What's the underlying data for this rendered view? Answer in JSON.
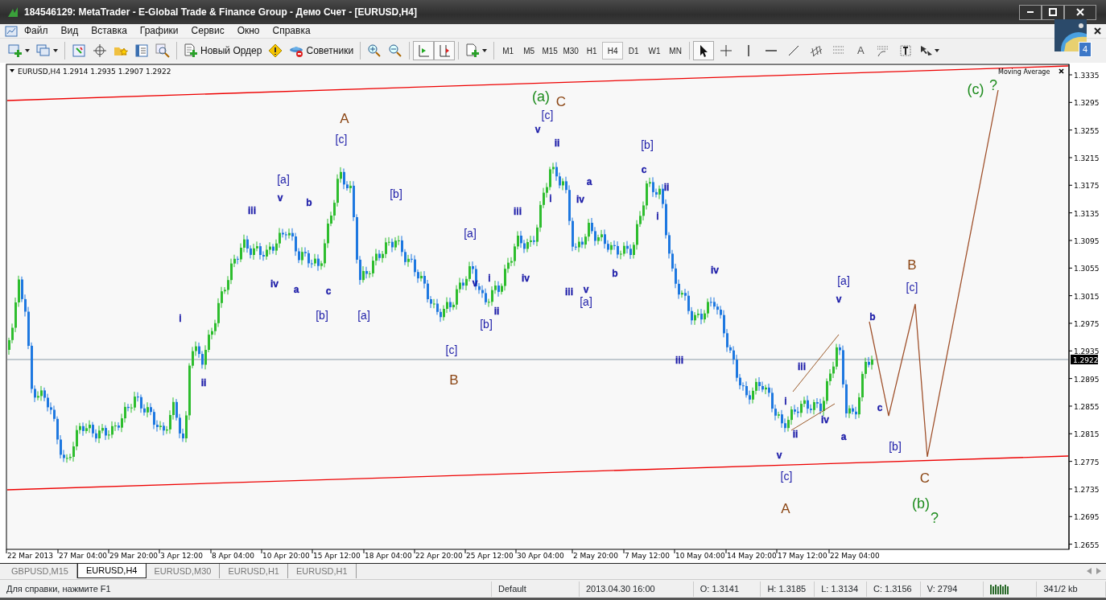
{
  "window": {
    "title": "184546129: MetaTrader - E-Global Trade & Finance Group - Демо Счет - [EURUSD,H4]"
  },
  "menu": [
    "Файл",
    "Вид",
    "Вставка",
    "Графики",
    "Сервис",
    "Окно",
    "Справка"
  ],
  "toolbar": {
    "new_order": "Новый Ордер",
    "experts": "Советники",
    "autoscroll_on": true,
    "chart_shift_on": true
  },
  "timeframes": [
    {
      "label": "M1",
      "selected": false
    },
    {
      "label": "M5",
      "selected": false
    },
    {
      "label": "M15",
      "selected": false
    },
    {
      "label": "M30",
      "selected": false
    },
    {
      "label": "H1",
      "selected": false
    },
    {
      "label": "H4",
      "selected": true
    },
    {
      "label": "D1",
      "selected": false
    },
    {
      "label": "W1",
      "selected": false
    },
    {
      "label": "MN",
      "selected": false
    }
  ],
  "draw_tools": [
    {
      "kind": "cursor",
      "selected": true
    },
    {
      "kind": "crosshair",
      "selected": false
    },
    {
      "kind": "vline",
      "selected": false
    },
    {
      "kind": "hline",
      "selected": false
    },
    {
      "kind": "trendline",
      "selected": false
    },
    {
      "kind": "channel",
      "selected": false
    },
    {
      "kind": "fibo",
      "selected": false
    },
    {
      "kind": "text",
      "label": "A",
      "selected": false
    },
    {
      "kind": "fibofan",
      "selected": false
    },
    {
      "kind": "textlabel",
      "selected": false
    },
    {
      "kind": "arrows",
      "selected": false
    }
  ],
  "notification": {
    "count": "4"
  },
  "chart": {
    "header": "EURUSD,H4  1.2914 1.2935 1.2907 1.2922",
    "indicator": "Moving Average",
    "current_price": "1.2922",
    "price_labels": [
      "1.3335",
      "1.3295",
      "1.3255",
      "1.3215",
      "1.3175",
      "1.3135",
      "1.3095",
      "1.3055",
      "1.3015",
      "1.2975",
      "1.2935",
      "1.2895",
      "1.2855",
      "1.2815",
      "1.2775",
      "1.2735",
      "1.2695",
      "1.2655"
    ],
    "time_labels": [
      "22 Mar 2013",
      "27 Mar 04:00",
      "29 Mar 20:00",
      "3 Apr 12:00",
      "8 Apr 04:00",
      "10 Apr 20:00",
      "15 Apr 12:00",
      "18 Apr 04:00",
      "22 Apr 20:00",
      "25 Apr 12:00",
      "30 Apr 04:00",
      "2 May 20:00",
      "7 May 12:00",
      "10 May 04:00",
      "14 May 20:00",
      "17 May 12:00",
      "22 May 04:00"
    ],
    "wave_labels": [
      {
        "text": "(a)",
        "color": "#1e8c1e"
      },
      {
        "text": "C",
        "color": "#8b4513"
      },
      {
        "text": "(c)",
        "color": "#1e8c1e"
      },
      {
        "text": "?",
        "color": "#1e8c1e"
      },
      {
        "text": "A",
        "color": "#8b4513"
      },
      {
        "text": "[c]",
        "color": "#1c1ca8"
      },
      {
        "text": "[c]",
        "color": "#1c1ca8"
      },
      {
        "text": "v",
        "color": "#1c1ca8"
      },
      {
        "text": "ii",
        "color": "#1c1ca8"
      },
      {
        "text": "[b]",
        "color": "#1c1ca8"
      },
      {
        "text": "[a]",
        "color": "#1c1ca8"
      },
      {
        "text": "c",
        "color": "#1c1ca8"
      },
      {
        "text": "a",
        "color": "#1c1ca8"
      },
      {
        "text": "ii",
        "color": "#1c1ca8"
      },
      {
        "text": "v",
        "color": "#1c1ca8"
      },
      {
        "text": "b",
        "color": "#1c1ca8"
      },
      {
        "text": "[b]",
        "color": "#1c1ca8"
      },
      {
        "text": "i",
        "color": "#1c1ca8"
      },
      {
        "text": "iv",
        "color": "#1c1ca8"
      },
      {
        "text": "iii",
        "color": "#1c1ca8"
      },
      {
        "text": "iii",
        "color": "#1c1ca8"
      },
      {
        "text": "i",
        "color": "#1c1ca8"
      },
      {
        "text": "[a]",
        "color": "#1c1ca8"
      },
      {
        "text": "b",
        "color": "#1c1ca8"
      },
      {
        "text": "iv",
        "color": "#1c1ca8"
      },
      {
        "text": "B",
        "color": "#8b4513"
      },
      {
        "text": "iv",
        "color": "#1c1ca8"
      },
      {
        "text": "a",
        "color": "#1c1ca8"
      },
      {
        "text": "c",
        "color": "#1c1ca8"
      },
      {
        "text": "v",
        "color": "#1c1ca8"
      },
      {
        "text": "i",
        "color": "#1c1ca8"
      },
      {
        "text": "iv",
        "color": "#1c1ca8"
      },
      {
        "text": "iii",
        "color": "#1c1ca8"
      },
      {
        "text": "v",
        "color": "#1c1ca8"
      },
      {
        "text": "[a]",
        "color": "#1c1ca8"
      },
      {
        "text": "[c]",
        "color": "#1c1ca8"
      },
      {
        "text": "[a]",
        "color": "#1c1ca8"
      },
      {
        "text": "v",
        "color": "#1c1ca8"
      },
      {
        "text": "i",
        "color": "#1c1ca8"
      },
      {
        "text": "[b]",
        "color": "#1c1ca8"
      },
      {
        "text": "[a]",
        "color": "#1c1ca8"
      },
      {
        "text": "ii",
        "color": "#1c1ca8"
      },
      {
        "text": "[b]",
        "color": "#1c1ca8"
      },
      {
        "text": "b",
        "color": "#1c1ca8"
      },
      {
        "text": "[c]",
        "color": "#1c1ca8"
      },
      {
        "text": "iii",
        "color": "#1c1ca8"
      },
      {
        "text": "iii",
        "color": "#1c1ca8"
      },
      {
        "text": "ii",
        "color": "#1c1ca8"
      },
      {
        "text": "B",
        "color": "#8b4513"
      },
      {
        "text": "i",
        "color": "#1c1ca8"
      },
      {
        "text": "c",
        "color": "#1c1ca8"
      },
      {
        "text": "iv",
        "color": "#1c1ca8"
      },
      {
        "text": "ii",
        "color": "#1c1ca8"
      },
      {
        "text": "a",
        "color": "#1c1ca8"
      },
      {
        "text": "v",
        "color": "#1c1ca8"
      },
      {
        "text": "[b]",
        "color": "#1c1ca8"
      },
      {
        "text": "[c]",
        "color": "#1c1ca8"
      },
      {
        "text": "C",
        "color": "#8b4513"
      },
      {
        "text": "A",
        "color": "#8b4513"
      },
      {
        "text": "(b)",
        "color": "#1e8c1e"
      },
      {
        "text": "?",
        "color": "#1e8c1e"
      }
    ]
  },
  "tabs": [
    {
      "label": "GBPUSD,M15",
      "selected": false
    },
    {
      "label": "EURUSD,H4",
      "selected": true
    },
    {
      "label": "EURUSD,M30",
      "selected": false
    },
    {
      "label": "EURUSD,H1",
      "selected": false
    },
    {
      "label": "EURUSD,H1",
      "selected": false
    }
  ],
  "status_bar": [
    "Для справки, нажмите F1",
    "Default",
    "2013.04.30 16:00",
    "O: 1.3141",
    "H: 1.3185",
    "L: 1.3134",
    "C: 1.3156",
    "V: 2794",
    "341/2 kb"
  ]
}
